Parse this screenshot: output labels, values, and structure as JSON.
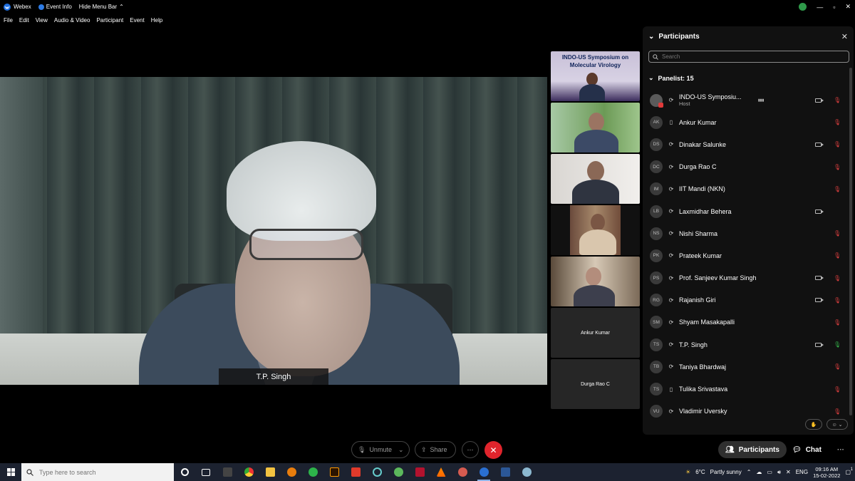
{
  "titlebar": {
    "app_name": "Webex",
    "event_info": "Event Info",
    "hide_menu_bar": "Hide Menu Bar",
    "window_controls": [
      "—",
      "▫",
      "✕"
    ]
  },
  "menu": [
    "File",
    "Edit",
    "View",
    "Audio & Video",
    "Participant",
    "Event",
    "Help"
  ],
  "main_video": {
    "speaker_name": "T.P. Singh"
  },
  "thumbnails": {
    "slide_title": "INDO-US Symposium on Molecular Virology",
    "empty_1": "Ankur Kumar",
    "empty_2": "Durga Rao C"
  },
  "panel": {
    "title": "Participants",
    "search_placeholder": "Search",
    "panelist_header": "Panelist: 15",
    "participants": [
      {
        "initials": "",
        "name": "INDO-US Symposiu...",
        "role": "Host",
        "device": "web",
        "camera": true,
        "mic": "muted",
        "speaking": true
      },
      {
        "initials": "AK",
        "name": "Ankur Kumar",
        "role": "",
        "device": "phone",
        "camera": false,
        "mic": "muted"
      },
      {
        "initials": "DS",
        "name": "Dinakar Salunke",
        "role": "",
        "device": "web",
        "camera": true,
        "mic": "muted"
      },
      {
        "initials": "DC",
        "name": "Durga Rao C",
        "role": "",
        "device": "web",
        "camera": false,
        "mic": "muted"
      },
      {
        "initials": "IM",
        "name": "IIT Mandi (NKN)",
        "role": "",
        "device": "web",
        "camera": false,
        "mic": "muted"
      },
      {
        "initials": "LB",
        "name": "Laxmidhar Behera",
        "role": "",
        "device": "web",
        "camera": true,
        "mic": "none"
      },
      {
        "initials": "NS",
        "name": "Nishi Sharma",
        "role": "",
        "device": "web",
        "camera": false,
        "mic": "muted"
      },
      {
        "initials": "PK",
        "name": "Prateek Kumar",
        "role": "",
        "device": "web",
        "camera": false,
        "mic": "muted"
      },
      {
        "initials": "PS",
        "name": "Prof. Sanjeev Kumar Singh",
        "role": "",
        "device": "web",
        "camera": true,
        "mic": "muted"
      },
      {
        "initials": "RG",
        "name": "Rajanish Giri",
        "role": "",
        "device": "web",
        "camera": true,
        "mic": "muted"
      },
      {
        "initials": "SM",
        "name": "Shyam Masakapalli",
        "role": "",
        "device": "web",
        "camera": false,
        "mic": "muted"
      },
      {
        "initials": "TS",
        "name": "T.P. Singh",
        "role": "",
        "device": "web",
        "camera": true,
        "mic": "on"
      },
      {
        "initials": "TB",
        "name": "Taniya Bhardwaj",
        "role": "",
        "device": "web",
        "camera": false,
        "mic": "muted"
      },
      {
        "initials": "TS",
        "name": "Tulika Srivastava",
        "role": "",
        "device": "phone",
        "camera": false,
        "mic": "muted"
      },
      {
        "initials": "VU",
        "name": "Vladimir Uversky",
        "role": "",
        "device": "web",
        "camera": false,
        "mic": "muted"
      }
    ]
  },
  "controls": {
    "unmute": "Unmute",
    "share": "Share",
    "more": "···",
    "participants": "Participants",
    "chat": "Chat",
    "overflow": "···"
  },
  "taskbar": {
    "search_placeholder": "Type here to search",
    "weather_temp": "6°C",
    "weather_text": "Partly sunny",
    "language": "ENG",
    "time": "09:16 AM",
    "date": "15-02-2022",
    "notification_count": "1"
  }
}
